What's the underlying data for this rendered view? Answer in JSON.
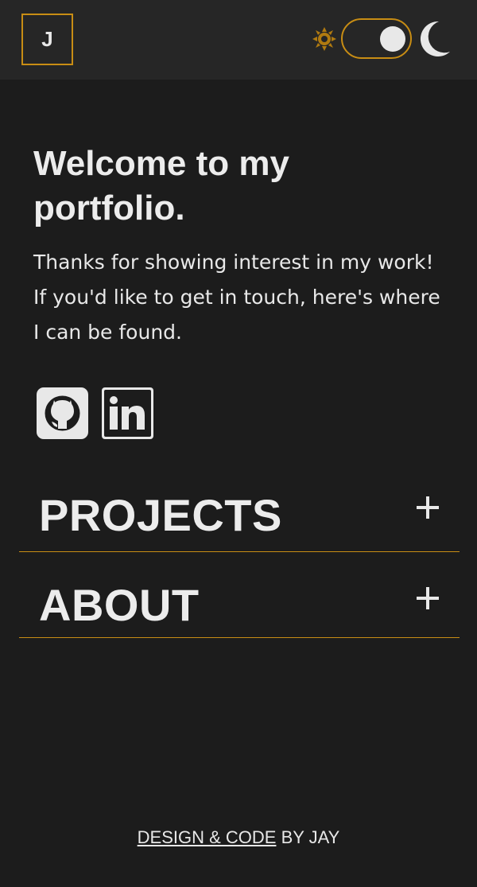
{
  "header": {
    "logo_letter": "J",
    "theme_toggle": {
      "state": "dark",
      "sun_icon": "sun-icon",
      "moon_icon": "moon-icon"
    }
  },
  "hero": {
    "title": "Welcome to my portfolio.",
    "intro": "Thanks for showing interest in my work! If you'd like to get in touch, here's where I can be found."
  },
  "socials": [
    {
      "name": "GitHub",
      "icon": "github-icon"
    },
    {
      "name": "LinkedIn",
      "icon": "linkedin-icon"
    }
  ],
  "sections": [
    {
      "label": "PROJECTS",
      "toggle": "+"
    },
    {
      "label": "ABOUT",
      "toggle": "+"
    }
  ],
  "footer": {
    "link_text": "DESIGN & CODE",
    "suffix": " BY JAY"
  },
  "colors": {
    "background": "#1c1c1c",
    "header": "#262626",
    "accent": "#c88d14",
    "text": "#e8e8e8"
  }
}
